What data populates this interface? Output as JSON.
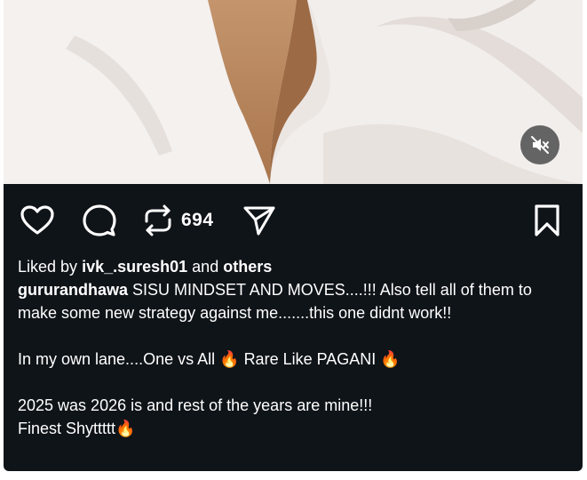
{
  "post": {
    "repost_count": "694",
    "liked_by": {
      "prefix": "Liked by",
      "user": "ivk_.suresh01",
      "connector": "and",
      "others": "others"
    },
    "caption": {
      "username": "gururandhawa",
      "line1": "SISU MINDSET AND MOVES....!!! Also tell all of them to make some new strategy against me.......this one didnt work!!",
      "line2_a": "In my own lane....One vs All",
      "line2_b": "Rare Like PAGANI",
      "line3": "2025 was 2026 is and rest of the years are mine!!!",
      "line4": "Finest Shyttttt",
      "fire_emoji": "🔥"
    }
  },
  "icons": {
    "like": "heart-icon",
    "comment": "comment-icon",
    "repost": "repost-icon",
    "share": "share-icon",
    "save": "bookmark-icon",
    "mute": "muted-speaker-icon"
  },
  "colors": {
    "background": "#0f1419",
    "text": "#ffffff"
  }
}
